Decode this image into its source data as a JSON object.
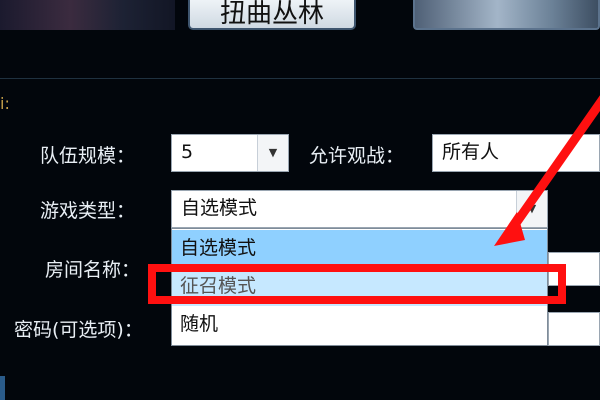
{
  "header": {
    "map_title": "扭曲丛林"
  },
  "form": {
    "section_label": "i:",
    "team_size": {
      "label": "队伍规模：",
      "value": "5"
    },
    "spectate": {
      "label": "允许观战：",
      "value": "所有人"
    },
    "game_type": {
      "label": "游戏类型：",
      "value": "自选模式",
      "options": [
        "自选模式",
        "征召模式",
        "随机"
      ]
    },
    "room_name": {
      "label": "房间名称："
    },
    "password": {
      "label": "密码(可选项)："
    }
  },
  "annotation": {
    "color": "#ff1010"
  }
}
